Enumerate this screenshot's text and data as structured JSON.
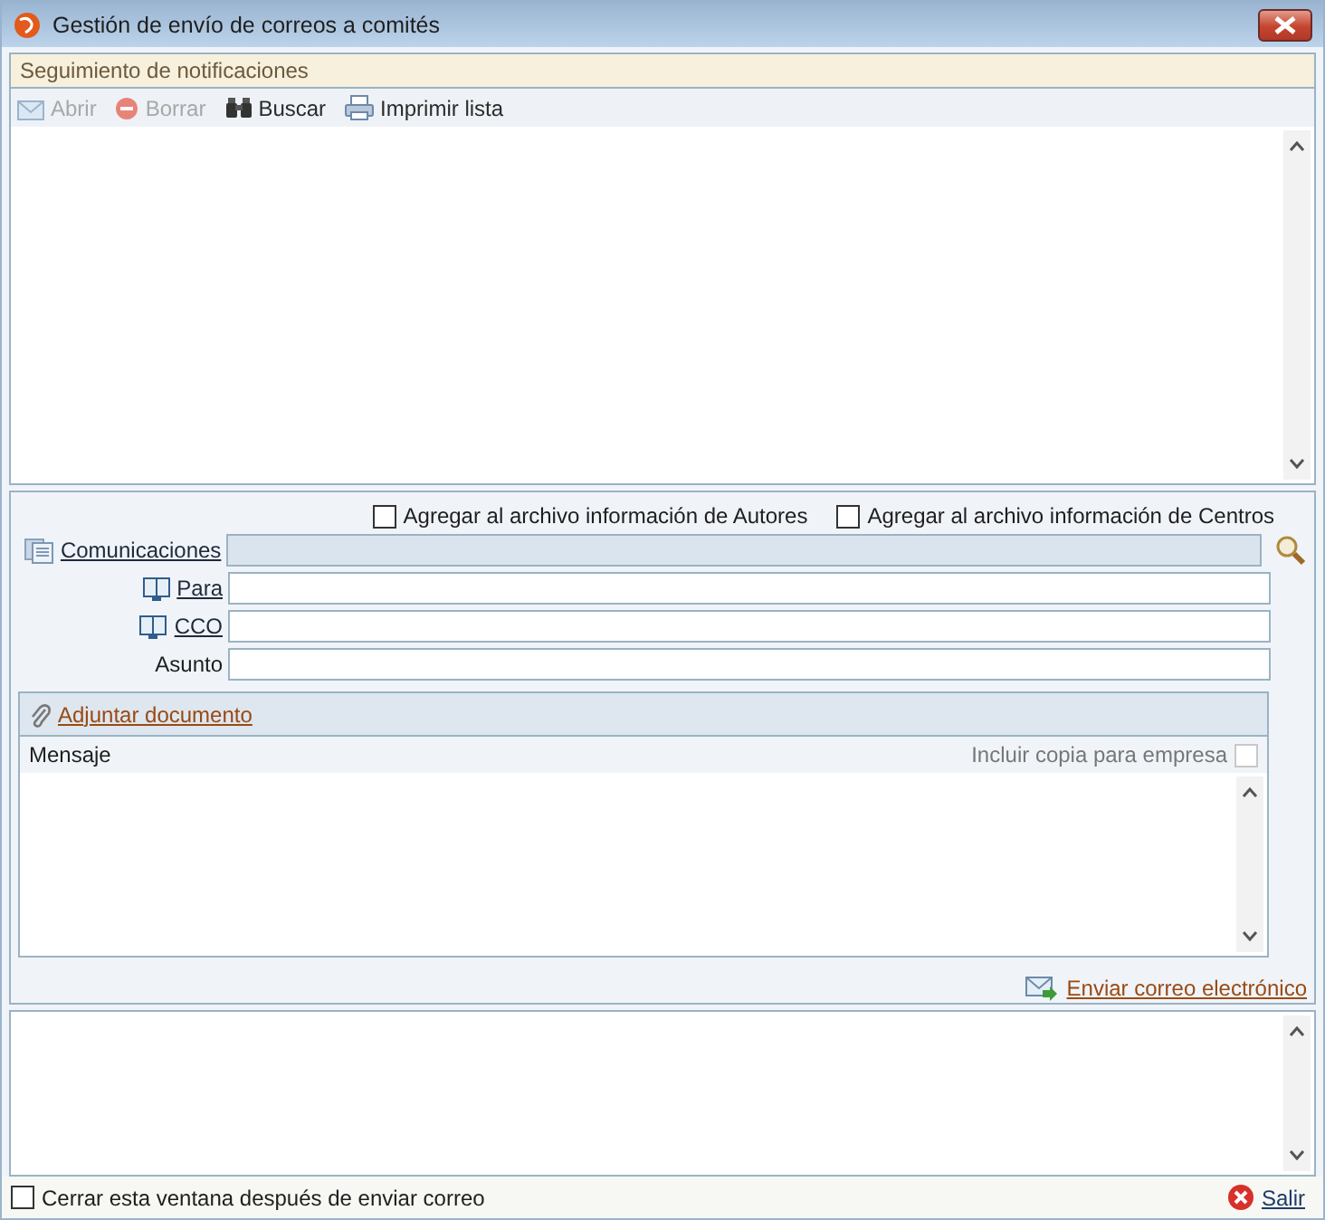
{
  "window": {
    "title": "Gestión de envío de correos a comités"
  },
  "section": {
    "title": "Seguimiento de notificaciones"
  },
  "toolbar": [
    {
      "label": "Abrir",
      "kind": "open",
      "disabled": true
    },
    {
      "label": "Borrar",
      "kind": "delete",
      "disabled": true
    },
    {
      "label": "Buscar",
      "kind": "find",
      "disabled": false
    },
    {
      "label": "Imprimir lista",
      "kind": "print",
      "disabled": false
    }
  ],
  "options": [
    {
      "label": "Agregar al archivo información de Autores",
      "checked": false
    },
    {
      "label": "Agregar al archivo información de Centros",
      "checked": false
    }
  ],
  "fields": [
    {
      "label": "Comunicaciones",
      "kind": "list",
      "disabled": true
    },
    {
      "label": "Para",
      "kind": "book",
      "disabled": false
    },
    {
      "label": "CCO",
      "kind": "book",
      "disabled": false
    },
    {
      "label": "Asunto",
      "kind": "plain",
      "disabled": false
    }
  ],
  "attach": {
    "label": "Adjuntar documento"
  },
  "message": {
    "label": "Mensaje",
    "copy_label": "Incluir copia para empresa",
    "copy_checked": false
  },
  "send": {
    "label": "Enviar correo electrónico"
  },
  "footer": {
    "close_after": {
      "label": "Cerrar esta ventana después de enviar correo",
      "checked": false
    },
    "exit": {
      "label": "Salir"
    }
  }
}
